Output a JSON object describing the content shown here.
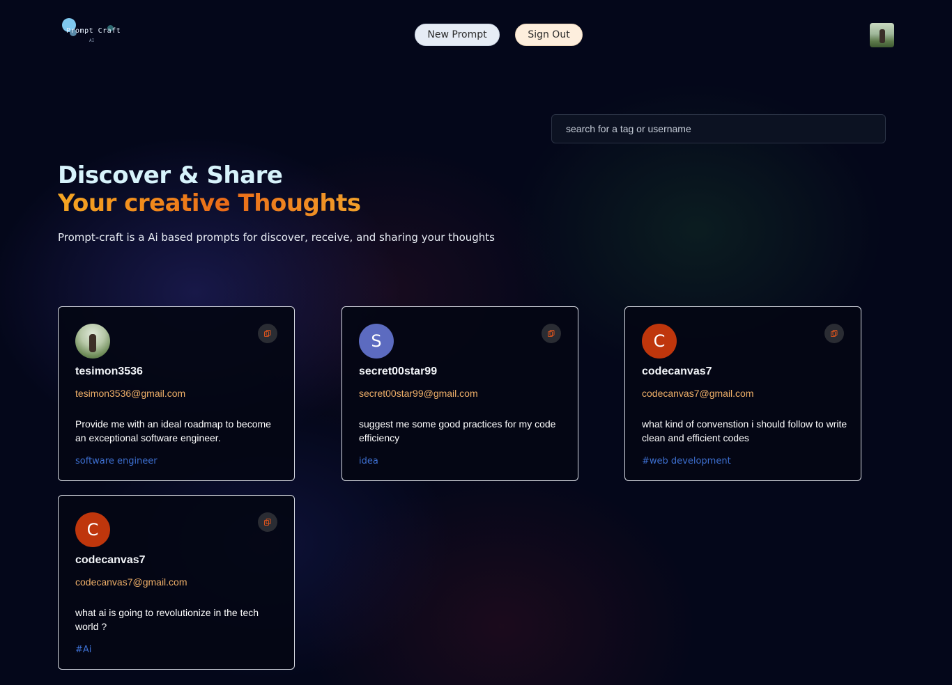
{
  "header": {
    "logo_text": "Prompt Craft",
    "logo_subtext": "AI",
    "new_prompt_label": "New Prompt",
    "sign_out_label": "Sign Out"
  },
  "search": {
    "placeholder": "search for a tag or username"
  },
  "hero": {
    "title_line1": "Discover & Share",
    "title_line2": "Your creative Thoughts",
    "subtitle": "Prompt-craft is a Ai based prompts for discover, receive, and sharing your thoughts"
  },
  "colors": {
    "accent_orange": "#f08a1c",
    "email_color": "#f0b069",
    "tag_color": "#3d6fd0",
    "avatar_blue": "#5c6bc0",
    "avatar_red": "#bf360c"
  },
  "cards": [
    {
      "avatar_type": "photo",
      "initial": "",
      "username": "tesimon3536",
      "email": "tesimon3536@gmail.com",
      "prompt": "Provide me with an ideal roadmap to become an exceptional software engineer.",
      "tag": "software engineer",
      "icon": "copy-icon"
    },
    {
      "avatar_type": "initial",
      "initial": "S",
      "username": "secret00star99",
      "email": "secret00star99@gmail.com",
      "prompt": "suggest me some good practices for my code efficiency",
      "tag": "idea",
      "icon": "copy-icon"
    },
    {
      "avatar_type": "initial",
      "initial": "C",
      "username": "codecanvas7",
      "email": "codecanvas7@gmail.com",
      "prompt": "what kind of convenstion i should follow to write clean and efficient codes",
      "tag": "#web development",
      "icon": "copy-icon"
    },
    {
      "avatar_type": "initial",
      "initial": "C",
      "username": "codecanvas7",
      "email": "codecanvas7@gmail.com",
      "prompt": "what ai is going to revolutionize in the tech world ?",
      "tag": "#Ai",
      "icon": "copy-icon"
    }
  ]
}
